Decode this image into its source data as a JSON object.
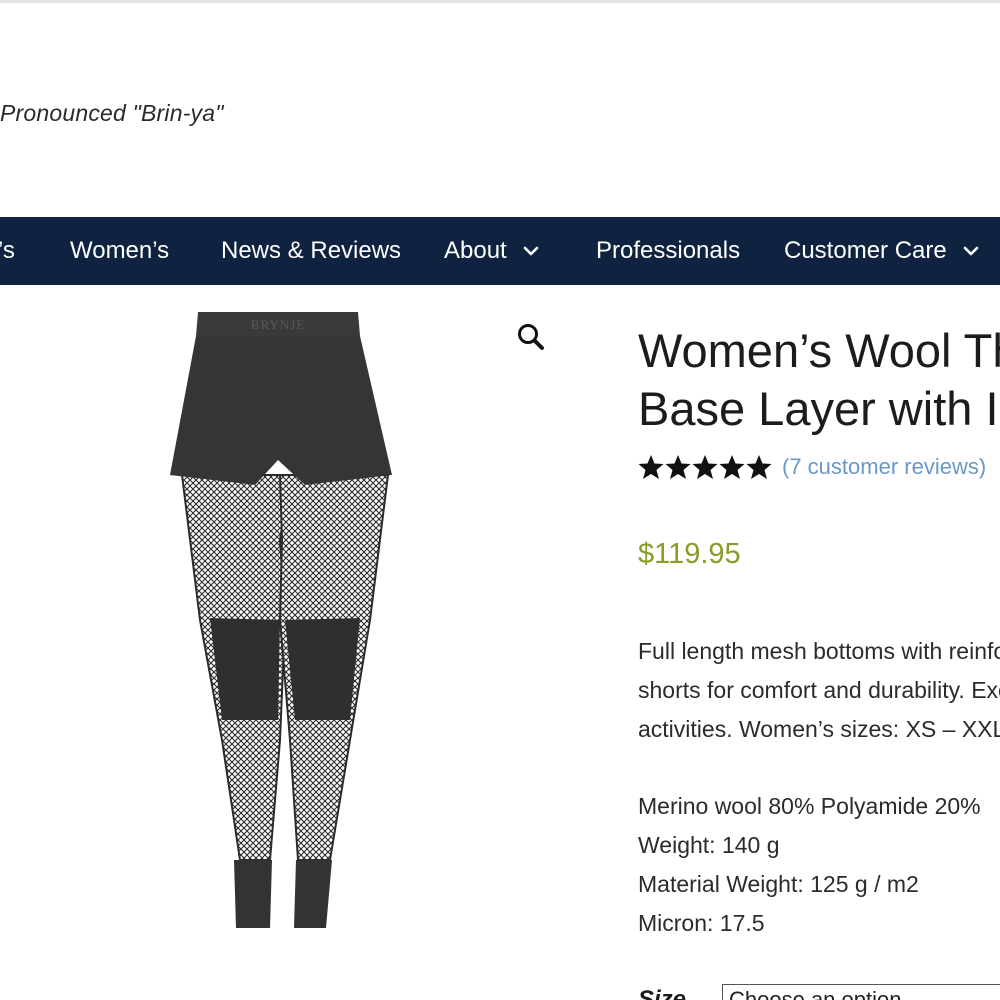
{
  "header": {
    "tagline": "Pronounced \"Brin-ya\""
  },
  "nav": {
    "items": [
      {
        "label": "’s"
      },
      {
        "label": "Women’s"
      },
      {
        "label": "News & Reviews"
      },
      {
        "label": "About"
      },
      {
        "label": "Professionals"
      },
      {
        "label": "Customer Care"
      }
    ]
  },
  "product": {
    "image_brand_text": "BRYNJE",
    "title_line1": "Women’s Wool Th",
    "title_line2": "Base Layer with In",
    "rating": {
      "stars": 5,
      "reviews_link": "(7 customer reviews)"
    },
    "price": "$119.95",
    "description_lines": [
      "Full length mesh bottoms with reinfo",
      "shorts for comfort and durability. Exc",
      "activities. Women’s sizes: XS – XXL."
    ],
    "specs": [
      "Merino wool 80% Polyamide 20%",
      "Weight: 140 g",
      "Material Weight: 125 g / m2",
      "Micron: 17.5"
    ],
    "size": {
      "label": "Size",
      "select_value": "Choose an option"
    }
  },
  "colors": {
    "nav_background": "#0f2340",
    "price": "#8c9a26",
    "link": "#6a97c7",
    "stars": "#111111"
  },
  "icons": {
    "zoom": "magnifier-icon",
    "dropdown": "chevron-down-icon",
    "rating": "star-icon"
  }
}
